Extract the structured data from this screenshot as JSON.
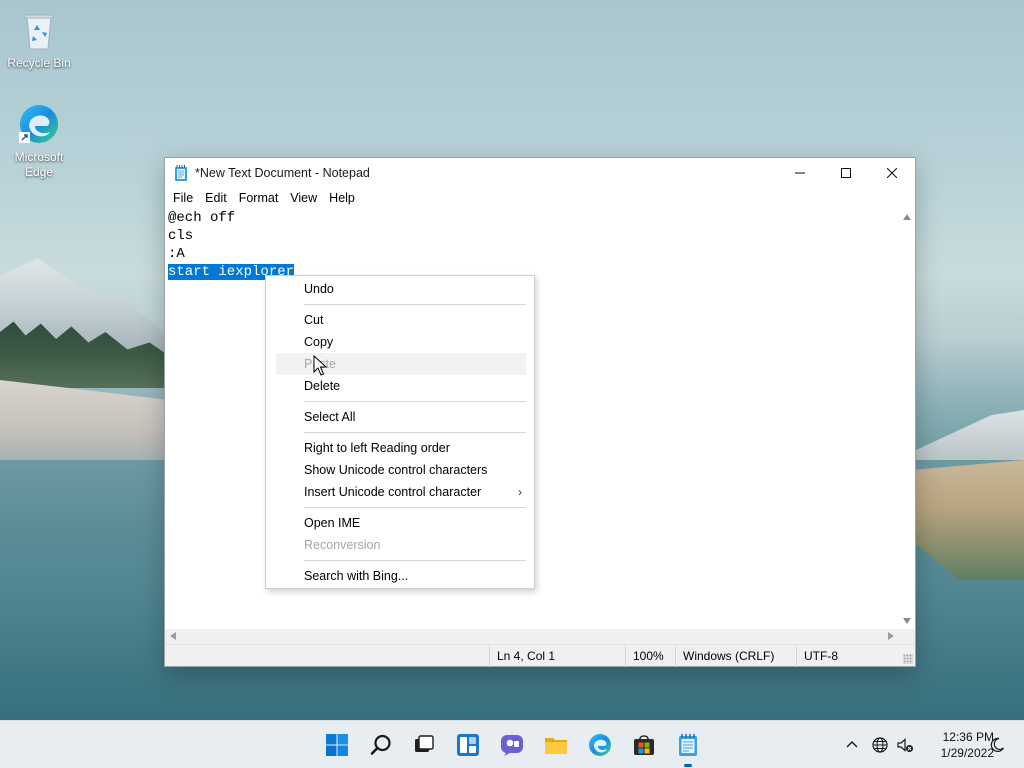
{
  "desktop": {
    "icons": [
      {
        "label": "Recycle Bin"
      },
      {
        "label_line1": "Microsoft",
        "label_line2": "Edge"
      }
    ]
  },
  "window": {
    "title": "*New Text Document - Notepad",
    "menu": [
      "File",
      "Edit",
      "Format",
      "View",
      "Help"
    ],
    "controls": {
      "minimize_icon": "minimize-icon",
      "maximize_icon": "maximize-icon",
      "close_icon": "close-icon"
    }
  },
  "editor": {
    "lines": [
      "@ech off",
      "cls",
      ":A",
      "start iexplorer"
    ],
    "selected_line_index": 3,
    "selection_color": "#0078d7"
  },
  "statusbar": {
    "position": "Ln 4, Col 1",
    "zoom": "100%",
    "line_ending": "Windows (CRLF)",
    "encoding": "UTF-8"
  },
  "context_menu": {
    "undo": "Undo",
    "cut": "Cut",
    "copy": "Copy",
    "paste": "Paste",
    "delete": "Delete",
    "select_all": "Select All",
    "rtl": "Right to left Reading order",
    "show_unicode": "Show Unicode control characters",
    "insert_unicode": "Insert Unicode control character",
    "open_ime": "Open IME",
    "reconversion": "Reconversion",
    "search_bing": "Search with Bing..."
  },
  "taskbar": {
    "apps": [
      "start-icon",
      "search-icon",
      "task-view-icon",
      "widgets-icon",
      "chat-icon",
      "file-explorer-icon",
      "edge-icon",
      "store-icon",
      "notepad-icon"
    ],
    "active_app": "notepad-icon",
    "clock": {
      "time": "12:36 PM",
      "date": "1/29/2022"
    },
    "accent": "#0067c0"
  }
}
